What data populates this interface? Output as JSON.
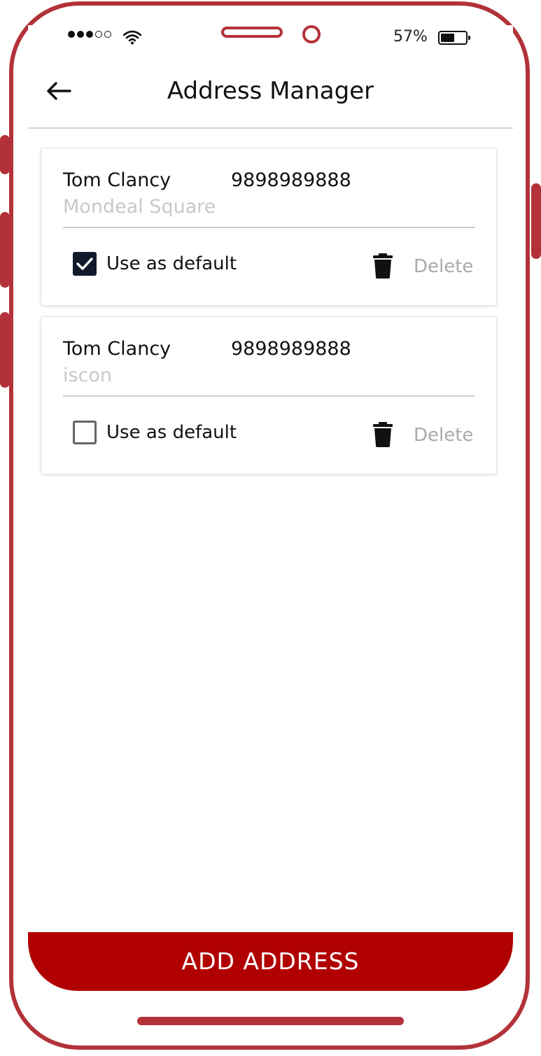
{
  "status_bar": {
    "signal_bars_filled": 3,
    "signal_bars_total": 5,
    "battery_percent_text": "57%",
    "battery_level": 0.57,
    "icons": [
      "wifi-icon",
      "battery-icon"
    ]
  },
  "header": {
    "title": "Address Manager",
    "back_icon": "arrow-left-icon"
  },
  "addresses": [
    {
      "name": "Tom Clancy",
      "phone": "9898989888",
      "address": "Mondeal Square",
      "default_label": "Use as default",
      "is_default": true,
      "delete_label": "Delete"
    },
    {
      "name": "Tom Clancy",
      "phone": "9898989888",
      "address": "iscon",
      "default_label": "Use as default",
      "is_default": false,
      "delete_label": "Delete"
    }
  ],
  "footer": {
    "add_button_label": "ADD ADDRESS"
  },
  "colors": {
    "frame": "#b3323a",
    "primary": "#b10000",
    "checkbox_checked": "#111a2a",
    "muted_text": "#aaaaaa"
  }
}
